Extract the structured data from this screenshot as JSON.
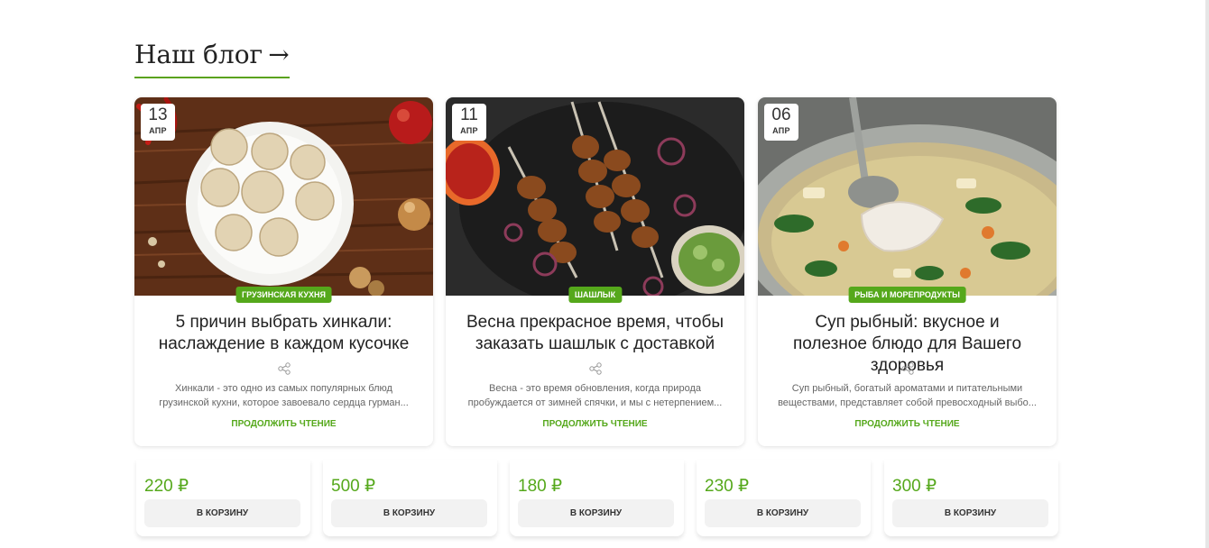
{
  "blog": {
    "title": "Наш блог",
    "arrow": "→"
  },
  "posts": [
    {
      "day": "13",
      "month": "АПР",
      "category": "Грузинская кухня",
      "title": "5 причин выбрать хинкали: наслаждение в каждом кусочке",
      "excerpt": "Хинкали - это одно из самых популярных блюд грузинской кухни, которое завоевало сердца гурман...",
      "read_more": "Продолжить чтение"
    },
    {
      "day": "11",
      "month": "АПР",
      "category": "Шашлык",
      "title": "Весна прекрасное время, чтобы заказать шашлык с доставкой",
      "excerpt": "Весна - это время обновления, когда природа пробуждается от зимней спячки, и мы с нетерпением...",
      "read_more": "Продолжить чтение"
    },
    {
      "day": "06",
      "month": "АПР",
      "category": "Рыба и морепродукты",
      "title": "Суп рыбный: вкусное и полезное блюдо для Вашего здоровья",
      "excerpt": "Суп рыбный, богатый ароматами и питательными веществами, представляет собой превосходный выбо...",
      "read_more": "Продолжить чтение"
    }
  ],
  "products": [
    {
      "price": "220 ₽",
      "button": "В корзину"
    },
    {
      "price": "500 ₽",
      "button": "В корзину"
    },
    {
      "price": "180 ₽",
      "button": "В корзину"
    },
    {
      "price": "230 ₽",
      "button": "В корзину"
    },
    {
      "price": "300 ₽",
      "button": "В корзину"
    }
  ],
  "colors": {
    "accent": "#55a81b",
    "text": "#222222",
    "muted": "#666666"
  }
}
